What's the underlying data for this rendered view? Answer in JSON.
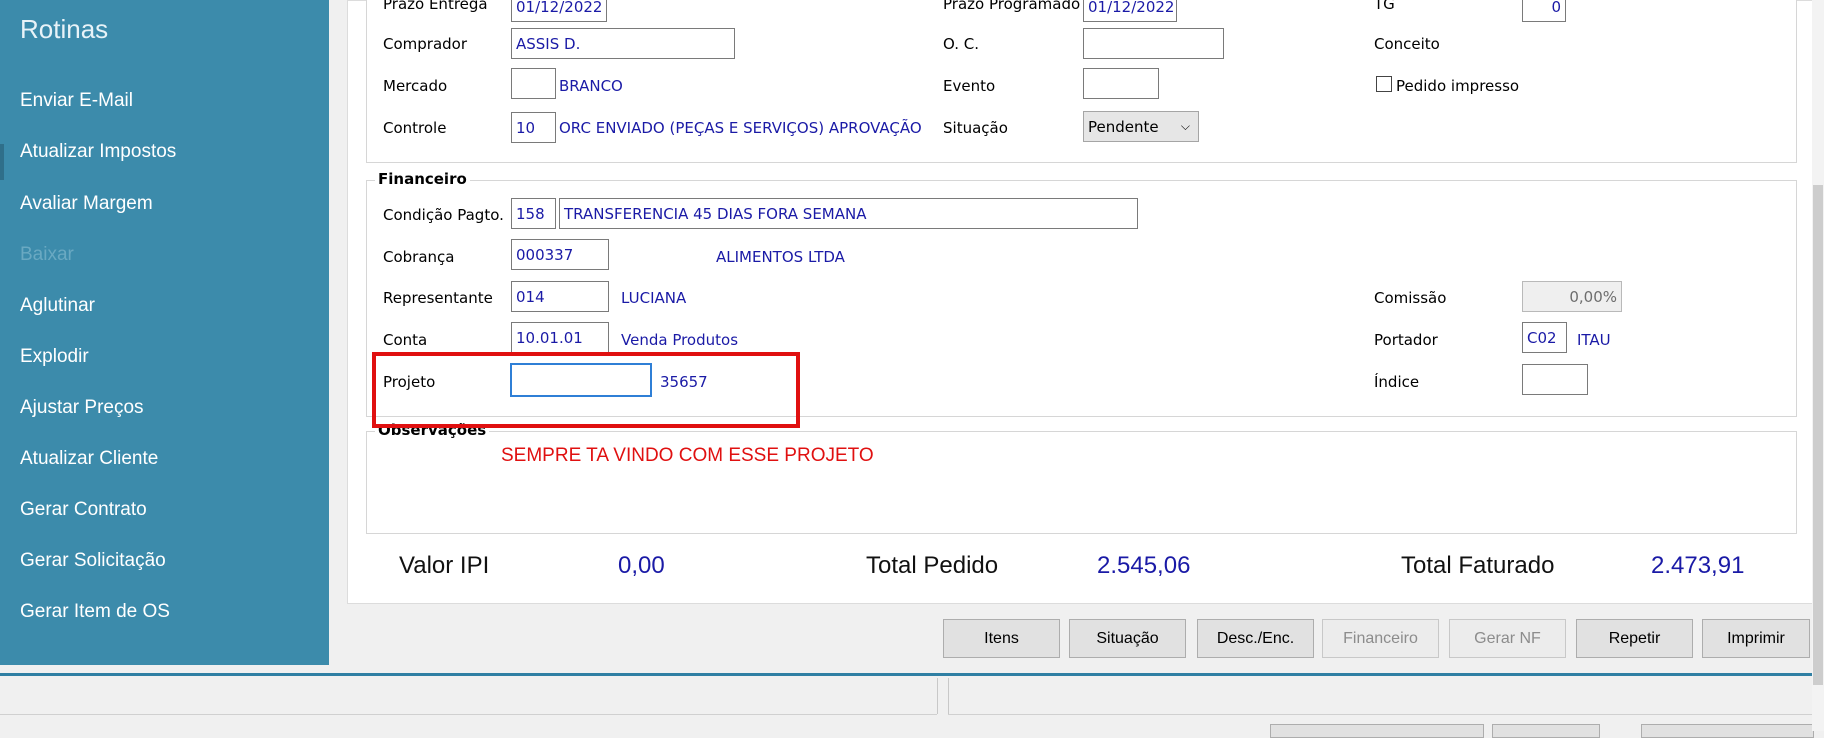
{
  "sidebar": {
    "title": "Rotinas",
    "items": [
      {
        "label": "Enviar E-Mail",
        "enabled": true
      },
      {
        "label": "Atualizar Impostos",
        "enabled": true
      },
      {
        "label": "Avaliar Margem",
        "enabled": true
      },
      {
        "label": "Baixar",
        "enabled": false
      },
      {
        "label": "Aglutinar",
        "enabled": true
      },
      {
        "label": "Explodir",
        "enabled": true
      },
      {
        "label": "Ajustar Preços",
        "enabled": true
      },
      {
        "label": "Atualizar Cliente",
        "enabled": true
      },
      {
        "label": "Gerar Contrato",
        "enabled": true
      },
      {
        "label": "Gerar Solicitação",
        "enabled": true
      },
      {
        "label": "Gerar Item de OS",
        "enabled": true
      }
    ]
  },
  "pedido": {
    "prazo_entrega": {
      "label": "Prazo Entrega",
      "value": "01/12/2022"
    },
    "prazo_programado": {
      "label": "Prazo Programado",
      "value": "01/12/2022"
    },
    "tg": {
      "label": "TG",
      "value": "0"
    },
    "comprador": {
      "label": "Comprador",
      "value": "ASSIS D."
    },
    "oc": {
      "label": "O. C.",
      "value": ""
    },
    "conceito": {
      "label": "Conceito"
    },
    "mercado": {
      "label": "Mercado",
      "code": "",
      "desc": "BRANCO"
    },
    "evento": {
      "label": "Evento",
      "value": ""
    },
    "pedido_impresso": {
      "label": "Pedido impresso",
      "checked": false
    },
    "controle": {
      "label": "Controle",
      "code": "10",
      "desc": "ORC ENVIADO (PEÇAS E SERVIÇOS) APROVAÇÃO"
    },
    "situacao": {
      "label": "Situação",
      "value": "Pendente"
    }
  },
  "financeiro": {
    "title": "Financeiro",
    "condicao": {
      "label": "Condição Pagto.",
      "code": "158",
      "desc": "TRANSFERENCIA 45 DIAS FORA SEMANA"
    },
    "cobranca": {
      "label": "Cobrança",
      "code": "000337",
      "desc": "ALIMENTOS LTDA"
    },
    "representante": {
      "label": "Representante",
      "code": "014",
      "desc": "LUCIANA"
    },
    "comissao": {
      "label": "Comissão",
      "value": "0,00%"
    },
    "conta": {
      "label": "Conta",
      "code": "10.01.01",
      "desc": "Venda Produtos"
    },
    "portador": {
      "label": "Portador",
      "code": "C02",
      "desc": "ITAU"
    },
    "projeto": {
      "label": "Projeto",
      "code": "",
      "desc": "35657"
    },
    "indice": {
      "label": "Índice",
      "value": ""
    }
  },
  "observacoes": {
    "title": "Observações",
    "annotation": "SEMPRE TA VINDO COM ESSE PROJETO"
  },
  "totals": {
    "valor_ipi": {
      "label": "Valor IPI",
      "value": "0,00"
    },
    "total_pedido": {
      "label": "Total Pedido",
      "value": "2.545,06"
    },
    "total_faturado": {
      "label": "Total Faturado",
      "value": "2.473,91"
    }
  },
  "buttons": {
    "itens": "Itens",
    "situacao": "Situação",
    "desc_enc": "Desc./Enc.",
    "financeiro": "Financeiro",
    "gerar_nf": "Gerar NF",
    "repetir": "Repetir",
    "imprimir": "Imprimir"
  },
  "colors": {
    "sidebar_bg": "#3c8bab",
    "field_text": "#1a1aa6",
    "annotation_red": "#e01010"
  }
}
